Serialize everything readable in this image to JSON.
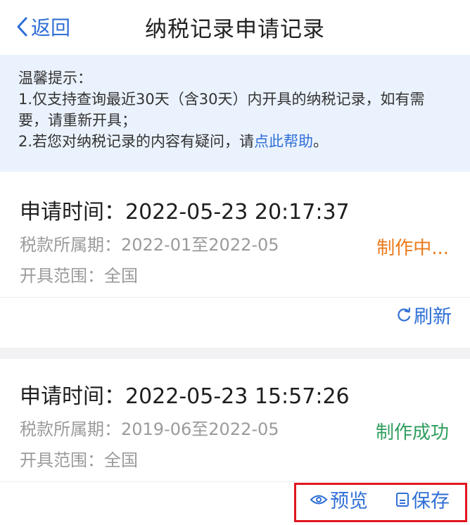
{
  "nav": {
    "back_label": "返回",
    "title": "纳税记录申请记录"
  },
  "notice": {
    "heading": "温馨提示：",
    "line1": "1.仅支持查询最近30天（含30天）内开具的纳税记录，如有需要，请重新开具；",
    "line2_prefix": "2.若您对纳税记录的内容有疑问，请",
    "line2_link": "点此帮助",
    "line2_suffix": "。"
  },
  "records": [
    {
      "request_time": "申请时间：2022-05-23 20:17:37",
      "tax_period": "税款所属期：2022-01至2022-05",
      "scope": "开具范围：全国",
      "status": "制作中...",
      "action_label": "刷新"
    },
    {
      "request_time": "申请时间：2022-05-23 15:57:26",
      "tax_period": "税款所属期：2019-06至2022-05",
      "scope": "开具范围：全国",
      "status": "制作成功",
      "preview_label": "预览",
      "save_label": "保存"
    }
  ],
  "colors": {
    "accent": "#2f6fd6",
    "status_making": "#ec7a1a",
    "status_success": "#2f9e5e",
    "highlight_border": "#e0161f"
  },
  "icons": [
    "chevron-left-icon",
    "refresh-icon",
    "eye-icon",
    "save-icon"
  ]
}
